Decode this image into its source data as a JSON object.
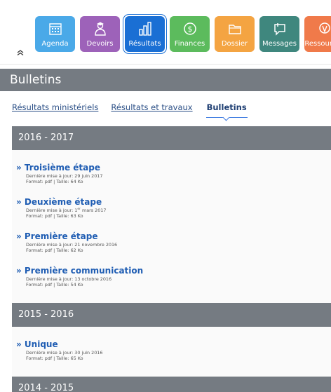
{
  "nav": {
    "items": [
      {
        "label": "Agenda",
        "icon": "calendar-icon",
        "color": "#4aa9e8",
        "active": false
      },
      {
        "label": "Devoirs",
        "icon": "student-icon",
        "color": "#9d62b9",
        "active": false
      },
      {
        "label": "Résultats",
        "icon": "bar-chart-icon",
        "color": "#1a6fd4",
        "active": true
      },
      {
        "label": "Finances",
        "icon": "coin-icon",
        "color": "#5cbb5d",
        "active": false
      },
      {
        "label": "Dossier",
        "icon": "folder-icon",
        "color": "#f4a442",
        "active": false
      },
      {
        "label": "Messages",
        "icon": "message-icon",
        "color": "#3f877e",
        "active": false
      },
      {
        "label": "Ressources",
        "icon": "resources-icon",
        "color": "#f07a4a",
        "active": false
      }
    ]
  },
  "page": {
    "title": "Bulletins"
  },
  "tabs": [
    {
      "label": "Résultats ministériels",
      "active": false
    },
    {
      "label": "Résultats et travaux",
      "active": false
    },
    {
      "label": "Bulletins",
      "active": true
    }
  ],
  "years": [
    {
      "label": "2016 - 2017",
      "items": [
        {
          "title": "» Troisième étape",
          "updated_label": "Dernière mise à jour:",
          "updated": "29 juin 2017",
          "format_label": "Format:",
          "format": "pdf",
          "size_label": "Taille:",
          "size": "64 Ko"
        },
        {
          "title": "» Deuxième étape",
          "updated_label": "Dernière mise à jour:",
          "updated": "1er mars 2017",
          "format_label": "Format:",
          "format": "pdf",
          "size_label": "Taille:",
          "size": "63 Ko"
        },
        {
          "title": "» Première étape",
          "updated_label": "Dernière mise à jour:",
          "updated": "21 novembre 2016",
          "format_label": "Format:",
          "format": "pdf",
          "size_label": "Taille:",
          "size": "62 Ko"
        },
        {
          "title": "» Première communication",
          "updated_label": "Dernière mise à jour:",
          "updated": "13 octobre 2016",
          "format_label": "Format:",
          "format": "pdf",
          "size_label": "Taille:",
          "size": "54 Ko"
        }
      ]
    },
    {
      "label": "2015 - 2016",
      "items": [
        {
          "title": "» Unique",
          "updated_label": "Dernière mise à jour:",
          "updated": "30 juin 2016",
          "format_label": "Format:",
          "format": "pdf",
          "size_label": "Taille:",
          "size": "65 Ko"
        }
      ]
    },
    {
      "label": "2014 - 2015",
      "items": []
    }
  ]
}
